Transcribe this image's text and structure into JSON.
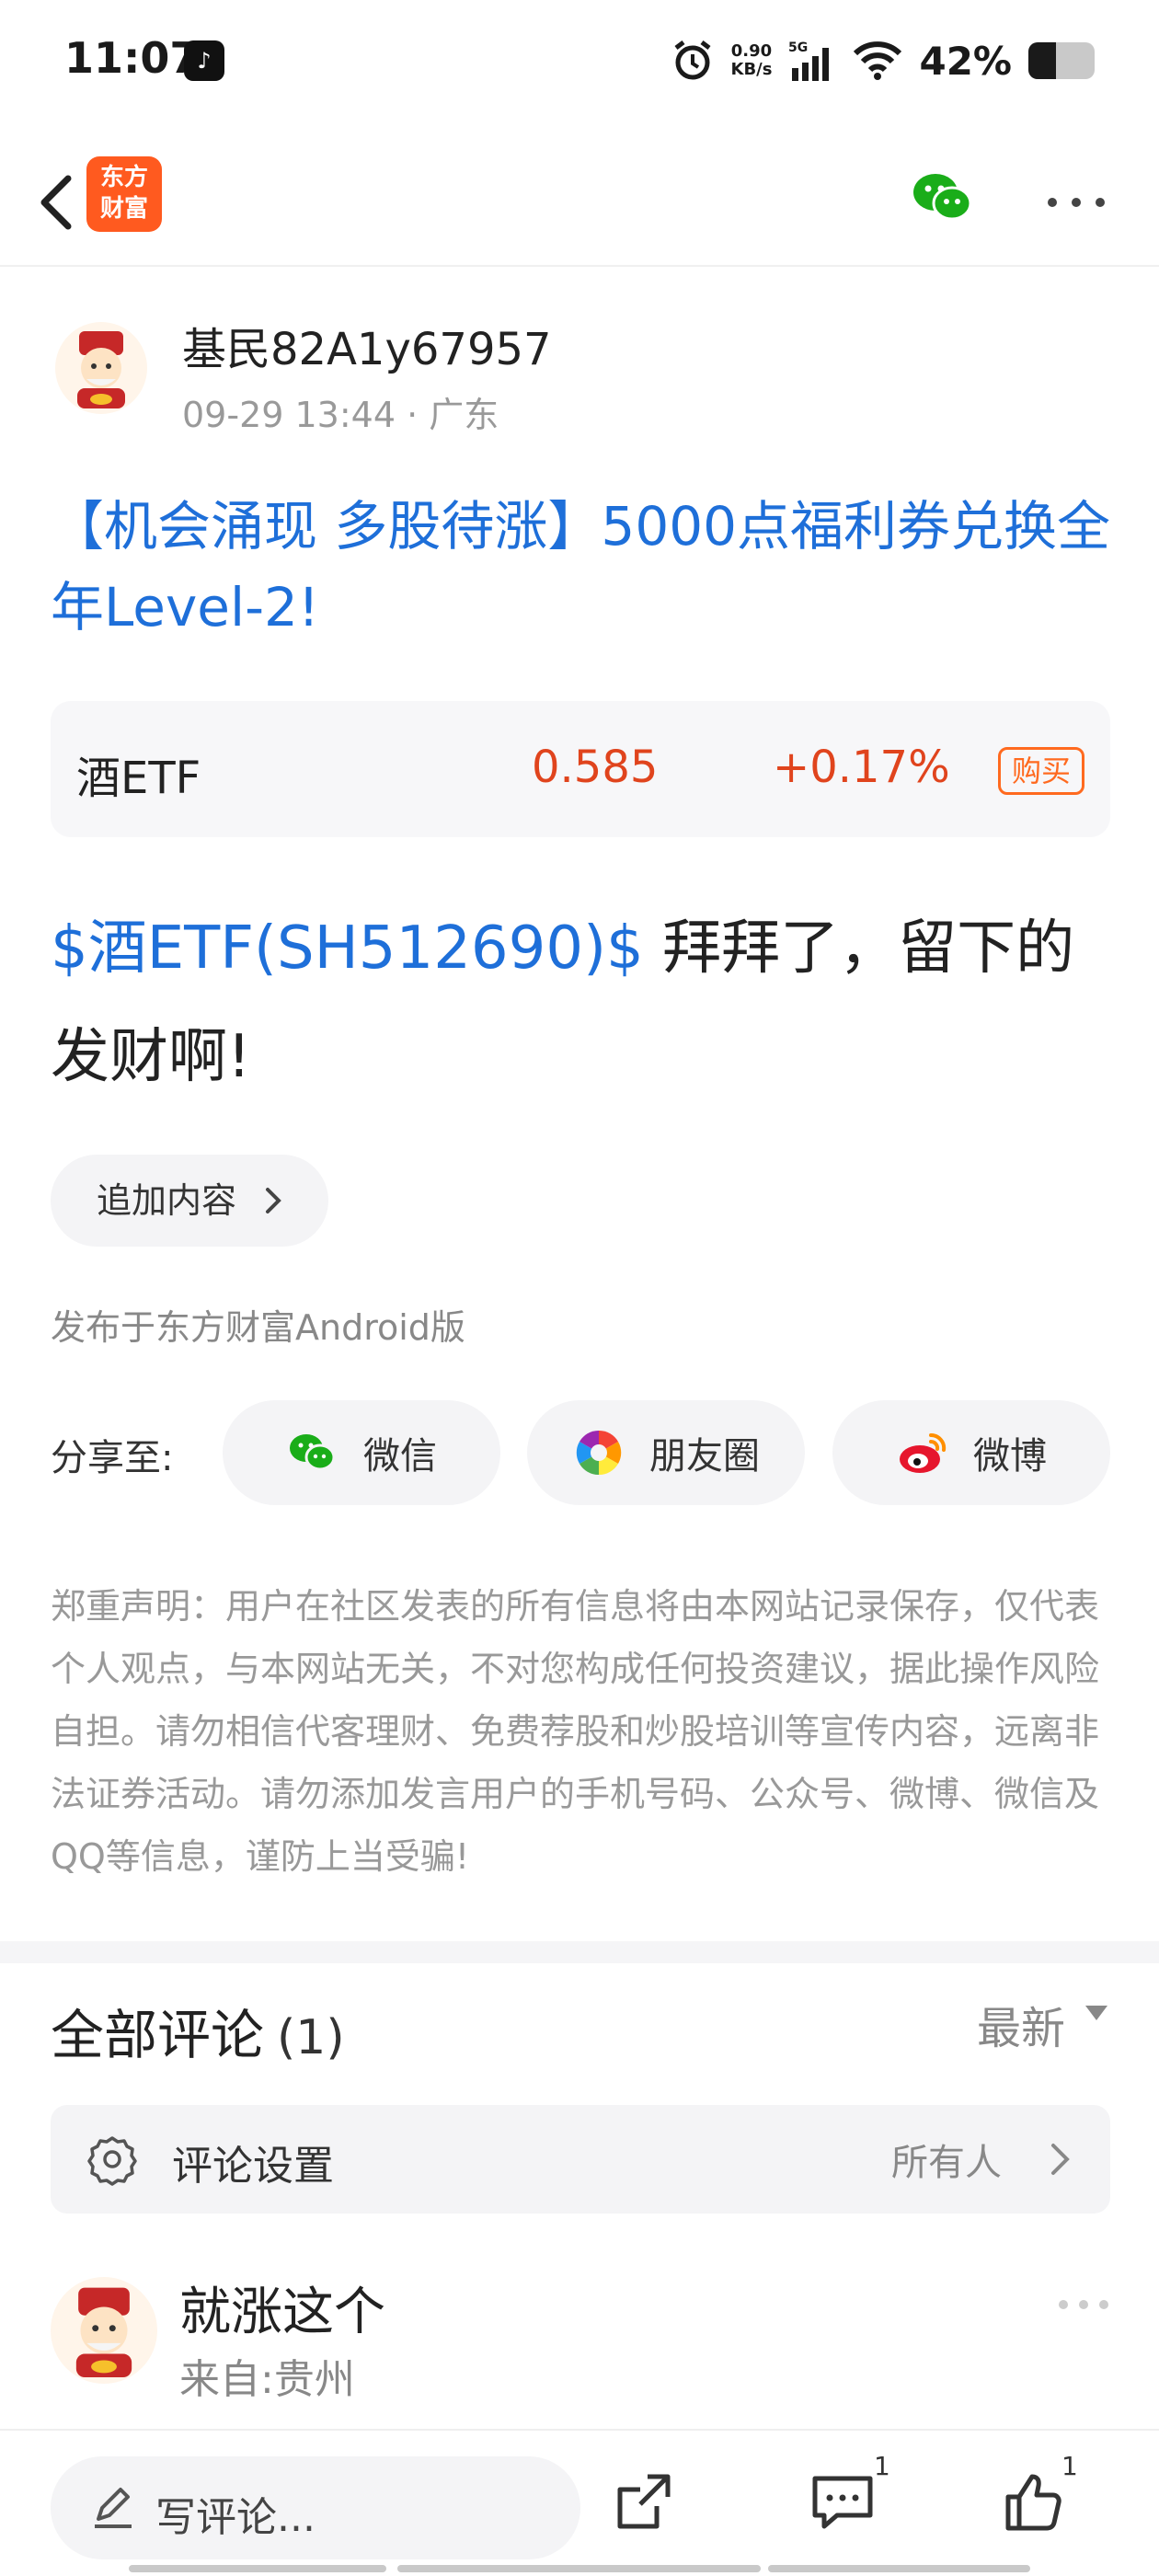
{
  "status_bar": {
    "time": "11:07",
    "net_speed_value": "0.90",
    "net_speed_unit": "KB/s",
    "network": "5G",
    "battery": "42%",
    "battery_level": 0.42,
    "icons": [
      "alarm-icon",
      "signal-icon",
      "wifi-icon",
      "battery-icon"
    ]
  },
  "nav": {
    "logo_line1": "东方",
    "logo_line2": "财富",
    "brand_color": "#ff5a1f"
  },
  "post": {
    "author": "基民82A1y67957",
    "meta": "09-29 13:44 · 广东",
    "title": "【机会涌现 多股待涨】5000点福利券兑换全年Level-2!",
    "stock_card": {
      "name": "酒ETF",
      "price": "0.585",
      "change": "+0.17%",
      "buy_label": "购买"
    },
    "body_link": "$酒ETF(SH512690)$",
    "body_text": " 拜拜了，留下的发财啊!",
    "add_content_label": "追加内容",
    "publish_source": "发布于东方财富Android版",
    "share": {
      "label": "分享至:",
      "targets": [
        "微信",
        "朋友圈",
        "微博"
      ]
    },
    "disclaimer": "郑重声明：用户在社区发表的所有信息将由本网站记录保存，仅代表个人观点，与本网站无关，不对您构成任何投资建议，据此操作风险自担。请勿相信代客理财、免费荐股和炒股培训等宣传内容，远离非法证券活动。请勿添加发言用户的手机号码、公众号、微博、微信及QQ等信息，谨防上当受骗!"
  },
  "comments": {
    "title": "全部评论",
    "count": "(1)",
    "sort": "最新",
    "settings_label": "评论设置",
    "settings_value": "所有人",
    "items": [
      {
        "text": "就涨这个",
        "location": "来自:贵州"
      }
    ]
  },
  "bottom_bar": {
    "write_placeholder": "写评论...",
    "comment_badge": "1",
    "like_badge": "1"
  },
  "colors": {
    "link_blue": "#1e6fd9",
    "price_red": "#e0441d",
    "accent_orange": "#ff6a1f",
    "wechat_green": "#1aad19"
  }
}
